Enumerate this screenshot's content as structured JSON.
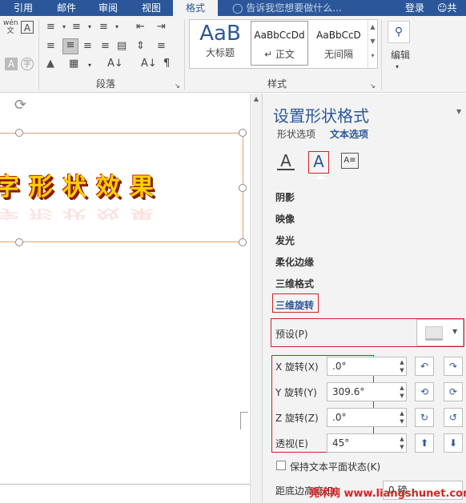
{
  "tabs": [
    "引用",
    "邮件",
    "审阅",
    "视图",
    "格式"
  ],
  "tellme": "告诉我您想要做什么...",
  "login": "登录",
  "share": "共",
  "ribbon": {
    "wen": "wén 文",
    "A": "A",
    "font_a": "A",
    "zi": "字",
    "paragraph_label": "段落",
    "styles_label": "样式",
    "edit_label": "编辑",
    "styles": [
      {
        "preview": "AaB",
        "name": "大标题"
      },
      {
        "preview": "AaBbCcDd",
        "name": "↵ 正文"
      },
      {
        "preview": "AaBbCcD",
        "name": "无间隔"
      }
    ]
  },
  "doc": {
    "wordart": "字形状效果"
  },
  "pane": {
    "title": "设置形状格式",
    "tab_shape": "形状选项",
    "tab_text": "文本选项",
    "sections": [
      "阴影",
      "映像",
      "发光",
      "柔化边缘",
      "三维格式",
      "三维旋转"
    ],
    "preset_label": "预设(P)",
    "rows": [
      {
        "label": "X 旋转(X)",
        "value": ".0°"
      },
      {
        "label": "Y 旋转(Y)",
        "value": "309.6°"
      },
      {
        "label": "Z 旋转(Z)",
        "value": ".0°"
      },
      {
        "label": "透视(E)",
        "value": "45°"
      }
    ],
    "keep_flat": "保持文本平面状态(K)",
    "distance_label": "距底边高度(D)",
    "distance_value": "0 磅"
  },
  "watermark": "亮术网 www.liangshunet.com",
  "colors": {
    "accent": "#2b579a",
    "highlight": "#d0202a"
  }
}
